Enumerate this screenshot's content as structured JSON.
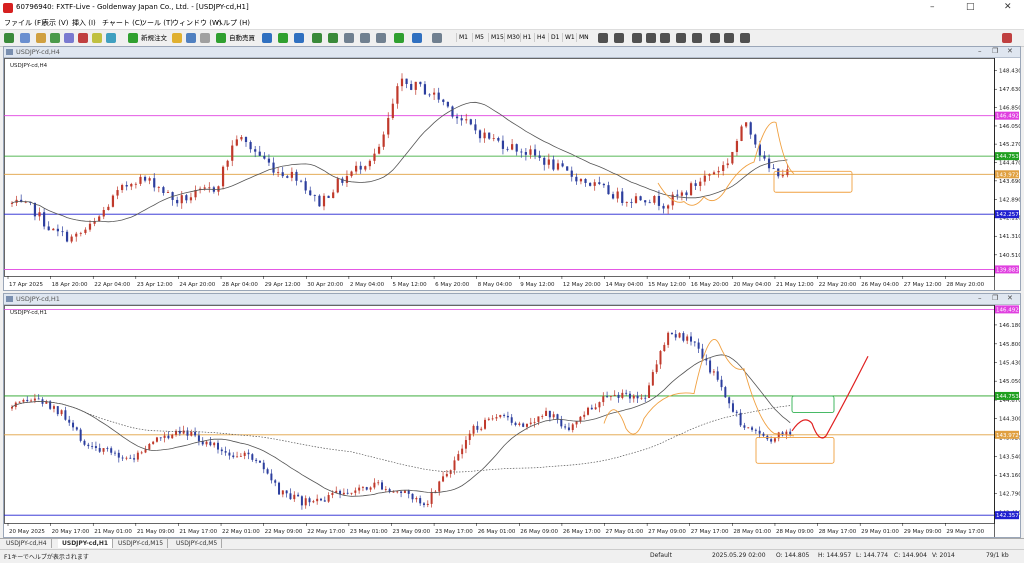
{
  "window": {
    "title": "60796940: FXTF-Live - Goldenway Japan Co., Ltd. - [USDJPY-cd,H1]"
  },
  "menu": {
    "items": [
      "ファイル (F)",
      "表示 (V)",
      "挿入 (I)",
      "チャート (C)",
      "ツール (T)",
      "ウィンドウ (W)",
      "ヘルプ (H)"
    ]
  },
  "toolbar": {
    "new_order": "新規注文",
    "auto_trading": "自動売買",
    "timeframes": [
      "M1",
      "M5",
      "M15",
      "M30",
      "H1",
      "H4",
      "D1",
      "W1",
      "MN"
    ]
  },
  "chart_h4": {
    "title": "USDJPY-cd,H4",
    "label": "USDJPY-cd,H4",
    "price_ticks": [
      "148.430",
      "147.630",
      "146.850",
      "146.050",
      "145.270",
      "144.470",
      "143.690",
      "142.890",
      "142.110",
      "141.310",
      "140.510"
    ],
    "hlines": [
      {
        "price": "146.492",
        "color": "#e040e0"
      },
      {
        "price": "144.753",
        "color": "#20a020"
      },
      {
        "price": "143.972",
        "color": "#e0a040"
      },
      {
        "price": "142.257",
        "color": "#2020d0"
      },
      {
        "price": "139.883",
        "color": "#e040e0"
      }
    ],
    "date_ticks": [
      "17 Apr 2025",
      "18 Apr 20:00",
      "22 Apr 04:00",
      "23 Apr 12:00",
      "24 Apr 20:00",
      "28 Apr 04:00",
      "29 Apr 12:00",
      "30 Apr 20:00",
      "2 May 04:00",
      "5 May 12:00",
      "6 May 20:00",
      "8 May 04:00",
      "9 May 12:00",
      "12 May 20:00",
      "14 May 04:00",
      "15 May 12:00",
      "16 May 20:00",
      "20 May 04:00",
      "21 May 12:00",
      "22 May 20:00",
      "26 May 04:00",
      "27 May 12:00",
      "28 May 20:00"
    ]
  },
  "chart_h1": {
    "title": "USDJPY-cd,H1",
    "label": "USDJPY-cd,H1",
    "price_ticks": [
      "146.180",
      "145.800",
      "145.430",
      "145.050",
      "144.670",
      "144.300",
      "143.920",
      "143.540",
      "143.160",
      "142.790",
      "142.410"
    ],
    "hlines": [
      {
        "price": "146.492",
        "color": "#e040e0"
      },
      {
        "price": "144.753",
        "color": "#20a020"
      },
      {
        "price": "143.972",
        "color": "#e0a040"
      },
      {
        "price": "142.357",
        "color": "#2020d0"
      }
    ],
    "date_ticks": [
      "20 May 2025",
      "20 May 17:00",
      "21 May 01:00",
      "21 May 09:00",
      "21 May 17:00",
      "22 May 01:00",
      "22 May 09:00",
      "22 May 17:00",
      "23 May 01:00",
      "23 May 09:00",
      "23 May 17:00",
      "26 May 01:00",
      "26 May 09:00",
      "26 May 17:00",
      "27 May 01:00",
      "27 May 09:00",
      "27 May 17:00",
      "28 May 01:00",
      "28 May 09:00",
      "28 May 17:00",
      "29 May 01:00",
      "29 May 09:00",
      "29 May 17:00"
    ]
  },
  "tabs": [
    "USDJPY-cd,H4",
    "USDJPY-cd,H1",
    "USDJPY-cd,M15",
    "USDJPY-cd,M5"
  ],
  "status": {
    "help": "F1キーでヘルプが表示されます",
    "profile": "Default",
    "time": "2025.05.29 02:00",
    "open": "O: 144.805",
    "high": "H: 144.957",
    "low": "L: 144.774",
    "close": "C: 144.904",
    "volume": "V: 2014",
    "memory": "79/1 kb"
  }
}
